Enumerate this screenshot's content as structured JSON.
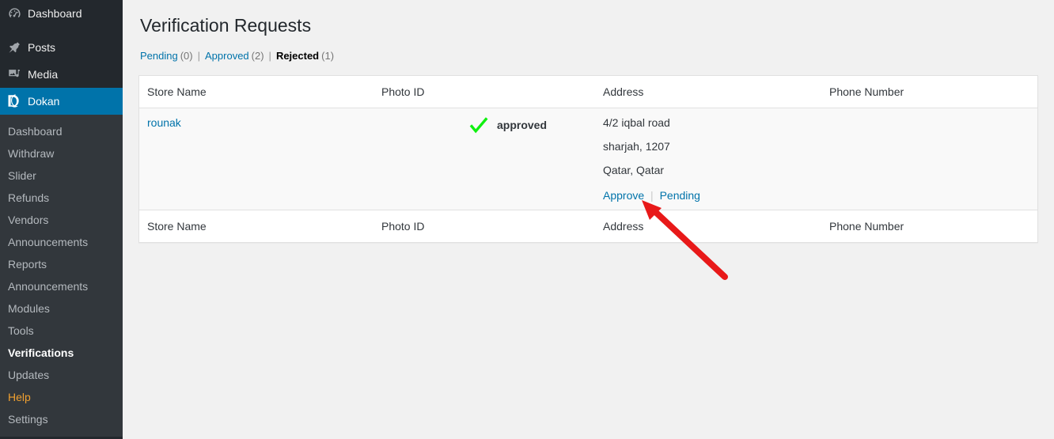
{
  "sidebar": {
    "top_items": [
      {
        "label": "Dashboard",
        "icon": "dashboard-gauge-icon",
        "current": false
      },
      {
        "label": "Posts",
        "icon": "pin-icon",
        "current": false
      },
      {
        "label": "Media",
        "icon": "media-icon",
        "current": false
      },
      {
        "label": "Dokan",
        "icon": "dokan-d-icon",
        "current": true
      }
    ],
    "submenu": [
      {
        "label": "Dashboard",
        "state": "normal"
      },
      {
        "label": "Withdraw",
        "state": "normal"
      },
      {
        "label": "Slider",
        "state": "normal"
      },
      {
        "label": "Refunds",
        "state": "normal"
      },
      {
        "label": "Vendors",
        "state": "normal"
      },
      {
        "label": "Announcements",
        "state": "normal"
      },
      {
        "label": "Reports",
        "state": "normal"
      },
      {
        "label": "Announcements",
        "state": "normal"
      },
      {
        "label": "Modules",
        "state": "normal"
      },
      {
        "label": "Tools",
        "state": "normal"
      },
      {
        "label": "Verifications",
        "state": "current"
      },
      {
        "label": "Updates",
        "state": "normal"
      },
      {
        "label": "Help",
        "state": "help"
      },
      {
        "label": "Settings",
        "state": "normal"
      }
    ],
    "colors": {
      "background": "#23282d",
      "submenu_background": "#32373c",
      "current_highlight": "#0073aa",
      "help_text": "#f0a030"
    }
  },
  "page": {
    "title": "Verification Requests",
    "status_filters": [
      {
        "label": "Pending",
        "count": "(0)",
        "current": false
      },
      {
        "label": "Approved",
        "count": "(2)",
        "current": false
      },
      {
        "label": "Rejected",
        "count": "(1)",
        "current": true
      }
    ],
    "separator": "|"
  },
  "table": {
    "columns": [
      "Store Name",
      "Photo ID",
      "Address",
      "Phone Number"
    ],
    "rows": [
      {
        "store_name": "rounak",
        "photo_id_status": "approved",
        "photo_id_icon": "green-check-icon",
        "address_lines": [
          "4/2 iqbal road",
          "sharjah, 1207",
          "Qatar, Qatar"
        ],
        "actions": [
          {
            "label": "Approve"
          },
          {
            "label": "Pending"
          }
        ],
        "action_separator": "|",
        "phone_number": ""
      }
    ]
  },
  "annotation": {
    "arrow": {
      "name": "red-pointer-arrow",
      "color": "#e81919",
      "points_at": "Approve"
    }
  }
}
